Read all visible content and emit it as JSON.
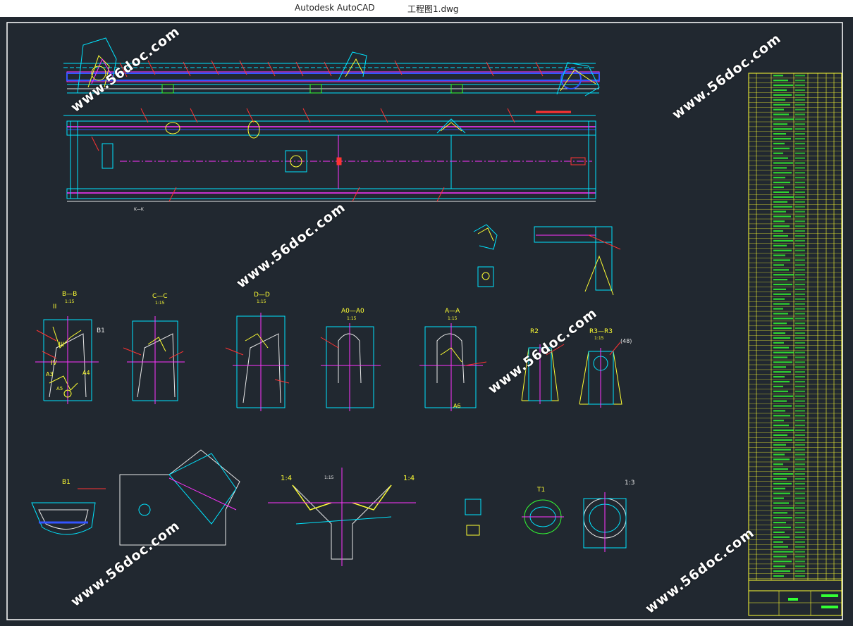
{
  "window": {
    "app_title": "Autodesk AutoCAD",
    "file_name": "工程图1.dwg"
  },
  "watermark": "www.56doc.com",
  "colors": {
    "background": "#212830",
    "border": "#ffffff",
    "cyan": "#00e5ff",
    "magenta": "#ff33ff",
    "yellow": "#ffff33",
    "green": "#33ff33",
    "red": "#ff3333",
    "blue": "#3355ff",
    "white": "#e8e8e8"
  },
  "section_labels": {
    "b_b": "B—B",
    "b_b_scale": "1:15",
    "c_c": "C—C",
    "c_c_scale": "1:15",
    "d_d": "D—D",
    "d_d_scale": "1:15",
    "a0_a0": "A0—A0",
    "a0_a0_scale": "1:15",
    "a_a": "A—A",
    "a_a_scale": "1:15",
    "r2_view": "R2",
    "r3_r3": "R3—R3",
    "r3_scale": "1:15",
    "r3_ref": "(48)",
    "b1": "B1",
    "b1_view": "B1",
    "t1_view": "T1",
    "k_k": "K—K",
    "roman_two": "II",
    "roman_three": "III",
    "roman_four": "IV",
    "a3": "A3",
    "a4": "A4",
    "a5": "A5",
    "a6": "A6",
    "ratio_1_4": "1:4",
    "ratio_1_3": "1:3",
    "scale_1_15": "1:15"
  }
}
